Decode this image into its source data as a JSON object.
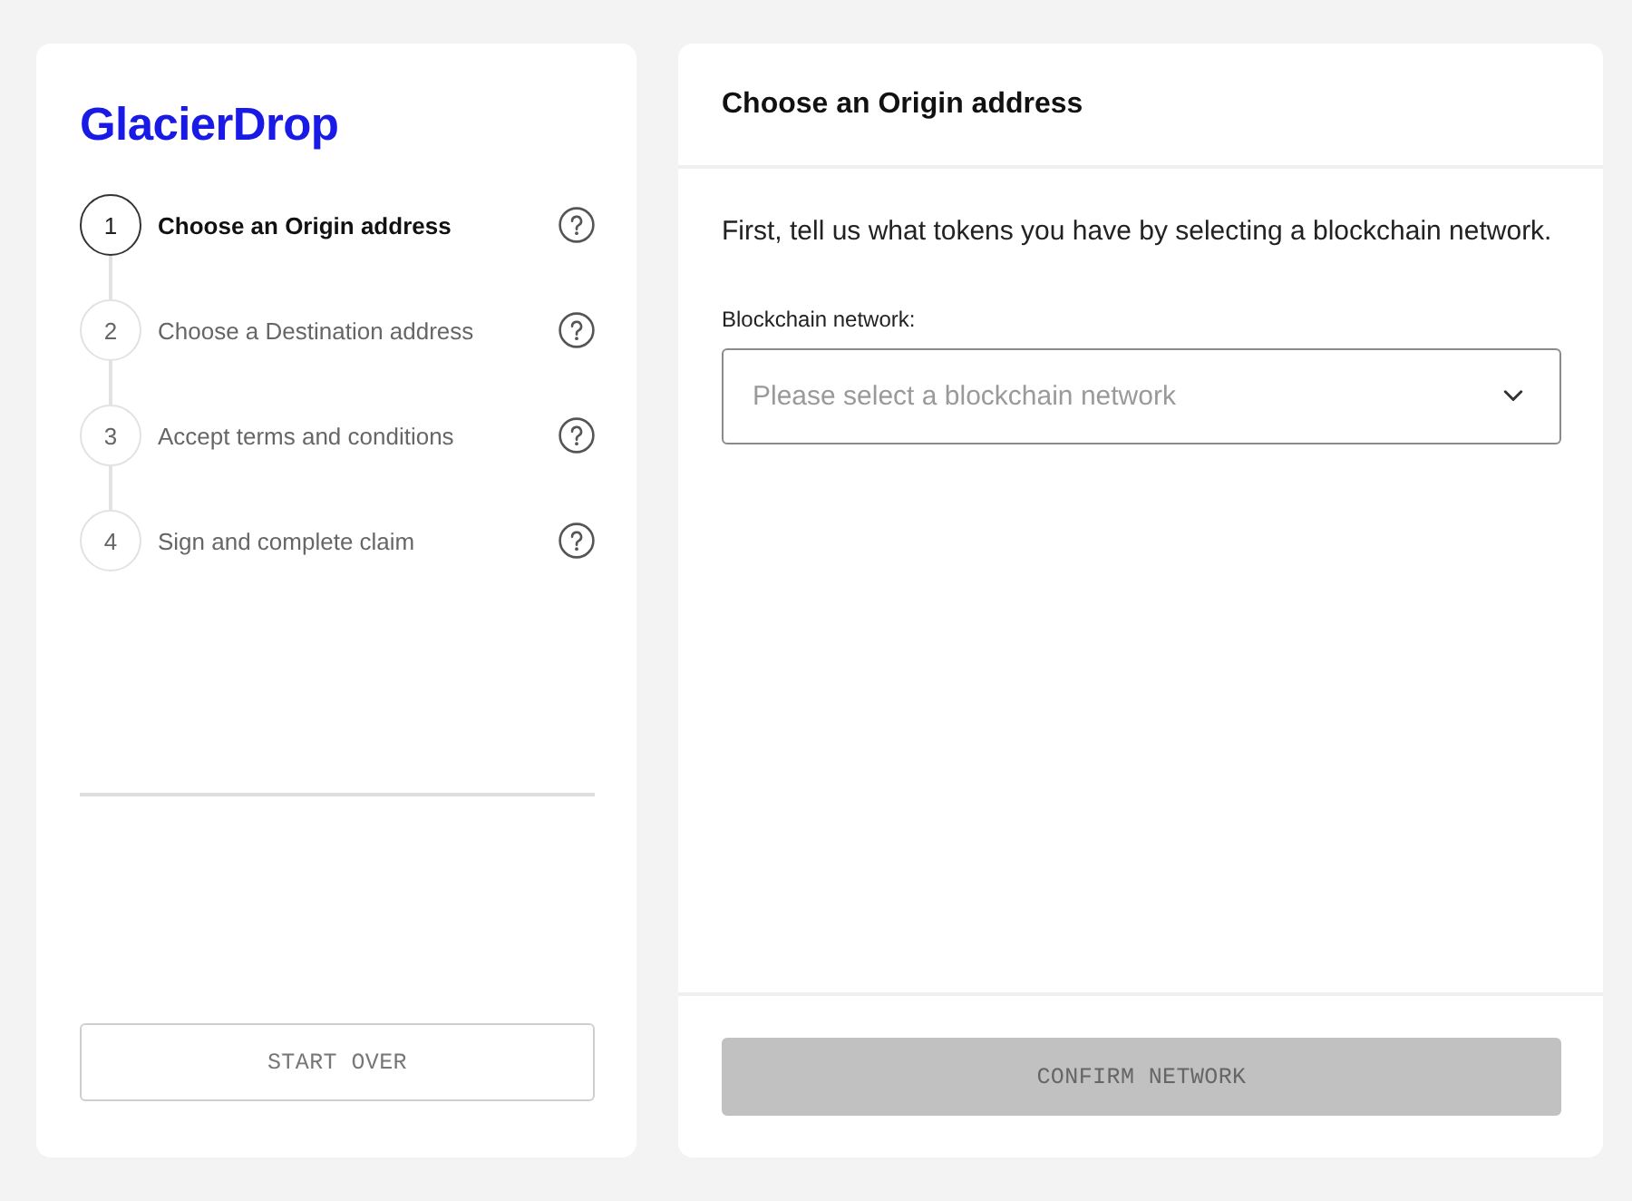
{
  "sidebar": {
    "logo": "GlacierDrop",
    "steps": [
      {
        "number": "1",
        "label": "Choose an Origin address",
        "selected": true
      },
      {
        "number": "2",
        "label": "Choose a Destination address",
        "selected": false
      },
      {
        "number": "3",
        "label": "Accept terms and conditions",
        "selected": false
      },
      {
        "number": "4",
        "label": "Sign and complete claim",
        "selected": false
      }
    ],
    "start_over_button": {
      "label": "START OVER",
      "disabled": false
    }
  },
  "main": {
    "title": "Choose an Origin address",
    "intro": "First, tell us what tokens you have by selecting a blockchain network.",
    "network_field": {
      "label": "Blockchain network:",
      "placeholder": "Please select a blockchain network"
    },
    "confirm_button": {
      "label": "CONFIRM NETWORK",
      "disabled": true
    }
  }
}
